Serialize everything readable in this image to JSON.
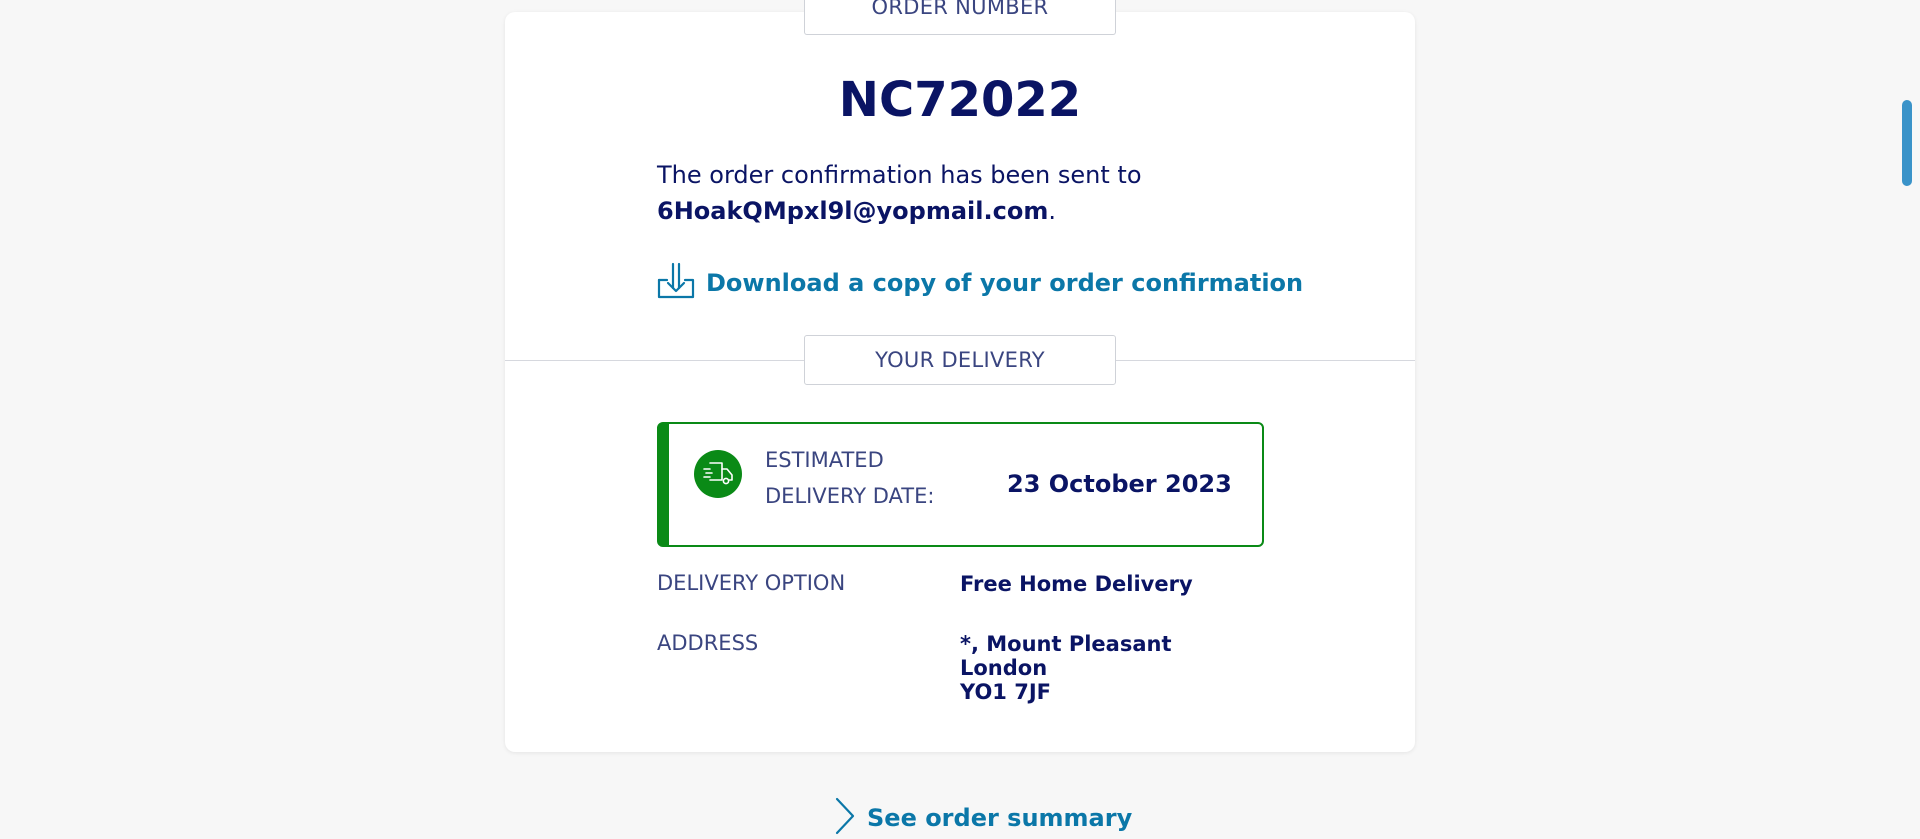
{
  "order": {
    "section_label": "ORDER NUMBER",
    "number": "NC72022",
    "confirmation_text": "The order confirmation has been sent to",
    "email": "6HoakQMpxl9l@yopmail.com",
    "email_suffix": ".",
    "download_label": "Download a copy of your order confirmation"
  },
  "delivery": {
    "section_label": "YOUR DELIVERY",
    "estimated_label": "ESTIMATED DELIVERY DATE:",
    "estimated_date": "23 October 2023",
    "option_label": "DELIVERY OPTION",
    "option_value": "Free Home Delivery",
    "address_label": "ADDRESS",
    "address_line1": "*, Mount Pleasant",
    "address_line2": "London",
    "address_line3": "YO1 7JF"
  },
  "summary_link": "See order summary",
  "icons": {
    "download": "download-icon",
    "truck": "delivery-truck-icon",
    "chevron": "chevron-right-icon"
  },
  "colors": {
    "text_primary": "#0a1464",
    "link": "#0b77a8",
    "success": "#0a8a16",
    "background": "#f7f7f7"
  }
}
